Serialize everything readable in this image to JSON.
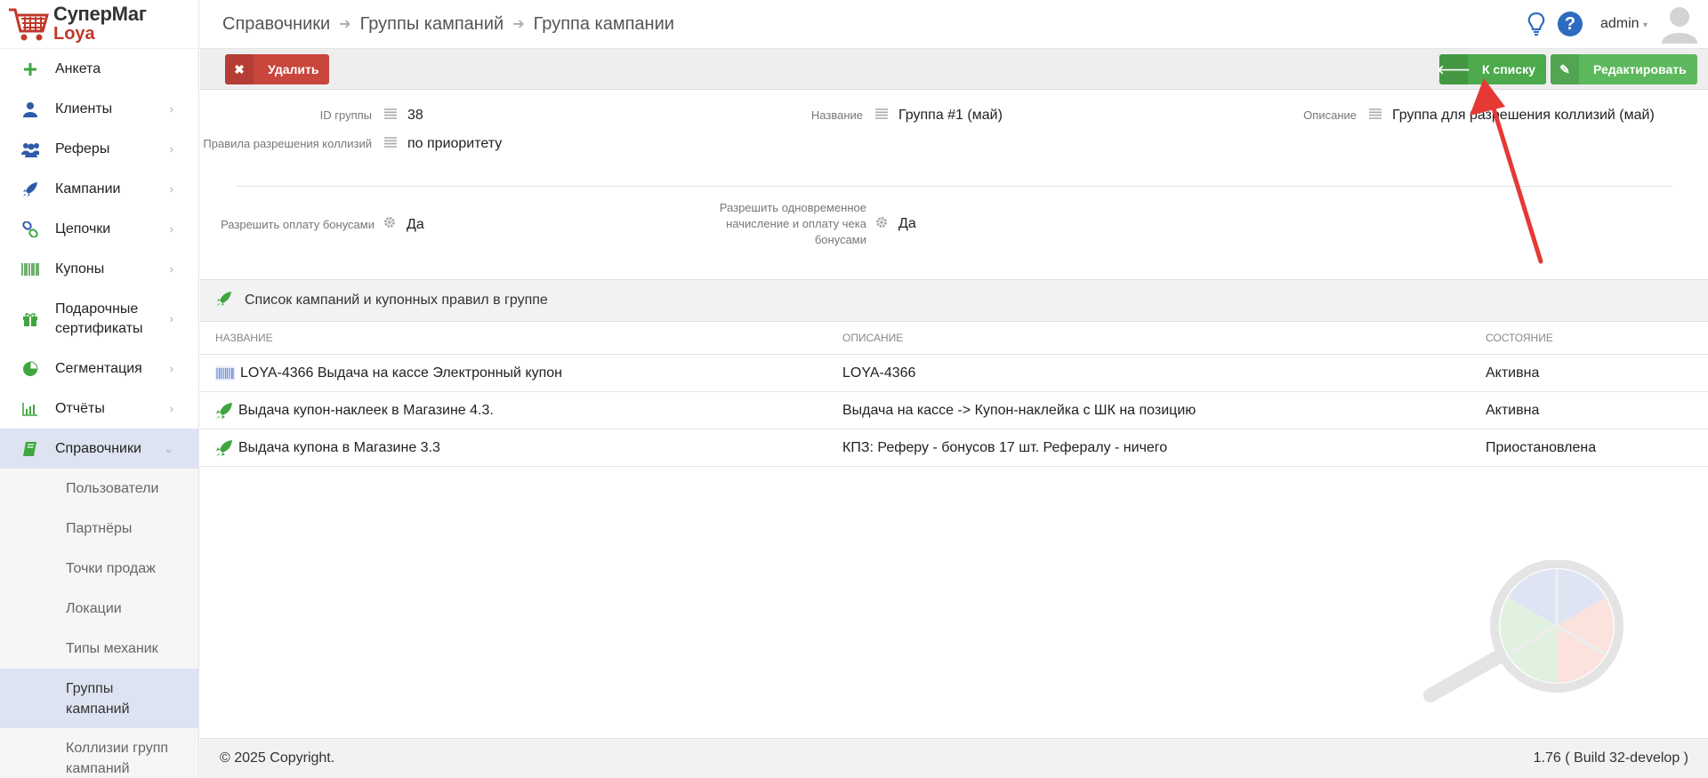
{
  "logo": {
    "title": "СуперМаг",
    "subtitle": "Loya"
  },
  "sidebar": {
    "items": [
      {
        "label": "Анкета"
      },
      {
        "label": "Клиенты"
      },
      {
        "label": "Реферы"
      },
      {
        "label": "Кампании"
      },
      {
        "label": "Цепочки"
      },
      {
        "label": "Купоны"
      },
      {
        "label": "Подарочные сертификаты"
      },
      {
        "label": "Сегментация"
      },
      {
        "label": "Отчёты"
      },
      {
        "label": "Справочники"
      }
    ],
    "subitems": [
      {
        "label": "Пользователи"
      },
      {
        "label": "Партнёры"
      },
      {
        "label": "Точки продаж"
      },
      {
        "label": "Локации"
      },
      {
        "label": "Типы механик"
      },
      {
        "label": "Группы кампаний"
      },
      {
        "label": "Коллизии групп кампаний"
      }
    ]
  },
  "header": {
    "breadcrumb": [
      "Справочники",
      "Группы кампаний",
      "Группа кампании"
    ],
    "user": "admin"
  },
  "toolbar": {
    "delete_label": "Удалить",
    "list_label": "К списку",
    "edit_label": "Редактировать"
  },
  "info": {
    "id_label": "ID группы",
    "id_value": "38",
    "name_label": "Название",
    "name_value": "Группа #1 (май)",
    "desc_label": "Описание",
    "desc_value": "Группа для разрешения коллизий (май)",
    "rules_label": "Правила разрешения коллизий",
    "rules_value": "по приоритету",
    "bonus_label": "Разрешить оплату бонусами",
    "bonus_value": "Да",
    "simul_label": "Разрешить одновременное начисление и оплату чека бонусами",
    "simul_value": "Да"
  },
  "section": {
    "title": "Список кампаний и купонных правил в группе"
  },
  "table": {
    "headers": [
      "НАЗВАНИЕ",
      "ОПИСАНИЕ",
      "СОСТОЯНИЕ"
    ],
    "rows": [
      {
        "icon": "barcode-icon",
        "name": "LOYA-4366 Выдача на кассе Электронный купон",
        "desc": "LOYA-4366",
        "state": "Активна"
      },
      {
        "icon": "rocket-icon",
        "name": "Выдача купон-наклеек в Магазине 4.3.",
        "desc": "Выдача на кассе -> Купон-наклейка с ШК на позицию",
        "state": "Активна"
      },
      {
        "icon": "rocket-icon",
        "name": "Выдача купона в Магазине 3.3",
        "desc": "КПЗ: Реферу - бонусов 17 шт. Рефералу - ничего",
        "state": "Приостановлена"
      }
    ]
  },
  "footer": {
    "copyright": "© 2025 Copyright.",
    "version": "1.76 ( Build 32-develop )"
  },
  "colors": {
    "accent_green": "#5cb85c",
    "danger": "#c9463d",
    "brand_red": "#c0392b",
    "active_bg": "#dde3f0"
  }
}
